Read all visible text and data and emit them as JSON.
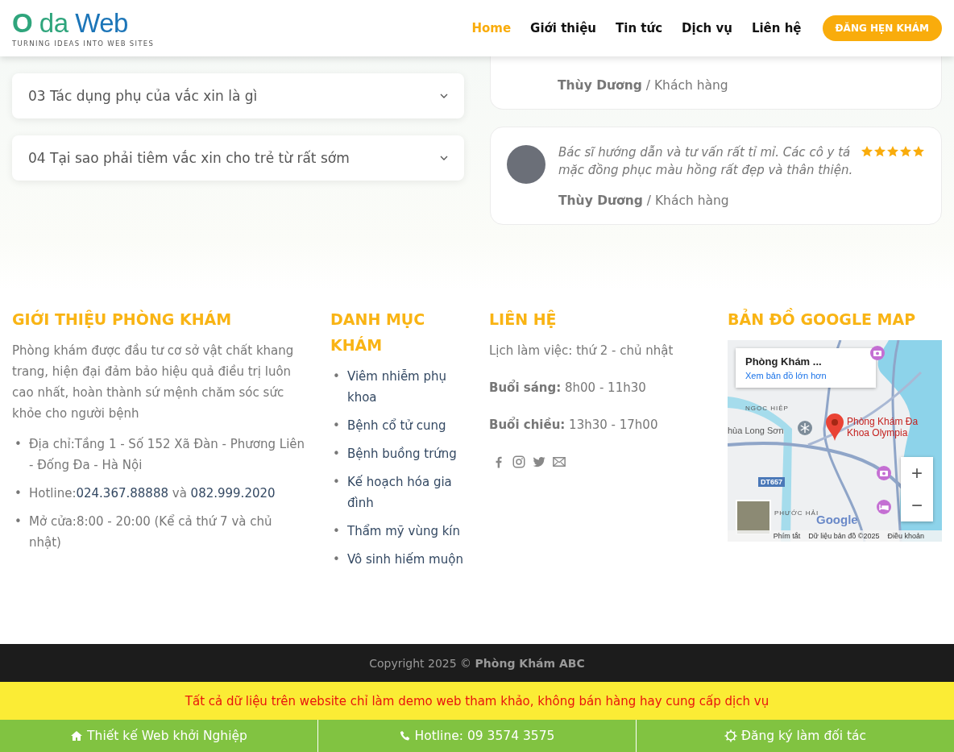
{
  "header": {
    "logo": {
      "parts": [
        "O",
        "da",
        "Web"
      ],
      "tagline": "TURNING IDEAS INTO WEB SITES"
    },
    "nav": [
      {
        "label": "Home",
        "selected": true
      },
      {
        "label": "Giới thiệu",
        "selected": false
      },
      {
        "label": "Tin tức",
        "selected": false
      },
      {
        "label": "Dịch vụ",
        "selected": false
      },
      {
        "label": "Liên hệ",
        "selected": false
      }
    ],
    "cta": "ĐĂNG HẸN KHÁM"
  },
  "faq": [
    {
      "question": "03 Tác dụng phụ của vắc xin là gì",
      "expanded": false
    },
    {
      "question": "04 Tại sao phải tiêm vắc xin cho trẻ từ rất sớm",
      "expanded": false
    }
  ],
  "testimonials": [
    {
      "kind": "partial",
      "author": "**Thùy Dương** / Khách hàng"
    },
    {
      "kind": "full",
      "quote": "Bác sĩ hướng dẫn và tư vấn rất tỉ mỉ. Các cô y tá mặc đồng phục màu hồng rất đẹp và thân thiện.",
      "stars": 5,
      "author": "**Thùy Dương** / Khách hàng"
    }
  ],
  "footer": {
    "bullet": "•",
    "about": {
      "title": "GIỚI THIỆU PHÒNG KHÁM",
      "text": "Phòng khám được đầu tư cơ sở vật chất khang trang, hiện đại đảm bảo hiệu quả điều trị luôn cao nhất, hoàn thành sứ mệnh chăm sóc sức khỏe cho người bệnh",
      "items": [
        {
          "kind": "text",
          "text": "Địa chỉ:Tầng 1 - Số 152 Xã Đàn - Phương Liên - Đống Đa - Hà Nội"
        },
        {
          "kind": "phones",
          "label": "Hotline:",
          "phones": [
            "024.367.88888",
            "082.999.2020"
          ],
          "joiner": "và"
        },
        {
          "kind": "text",
          "text": "Mở cửa:8:00 - 20:00 (Kể cả thứ 7 và chủ nhật)"
        }
      ]
    },
    "categories": {
      "title": "DANH MỤC KHÁM",
      "items": [
        "Viêm nhiễm phụ khoa",
        "Bệnh cổ tử cung",
        "Bệnh buồng trứng",
        "Kế hoạch hóa gia đình",
        "Thẩm mỹ vùng kín",
        "Vô sinh hiếm muộn"
      ]
    },
    "contact": {
      "title": "LIÊN HỆ",
      "lines": [
        "Lịch làm việc: thứ 2 - chủ nhật",
        "**Buổi sáng:** 8h00 - 11h30",
        "**Buổi chiều:** 13h30 - 17h00"
      ],
      "socials": [
        {
          "kind": "facebook"
        },
        {
          "kind": "instagram"
        },
        {
          "kind": "twitter"
        },
        {
          "kind": "email"
        }
      ]
    },
    "map": {
      "title": "BẢN ĐỒ GOOGLE MAP",
      "popup_title": "Phòng Khám ...",
      "popup_link": "Xem bản đồ lớn hơn",
      "labels": [
        "NGỌC HIỆP",
        "hùa Long Sơn",
        "PHƯỚC HẢI"
      ],
      "pin_label": [
        "Phòng Khám Đa",
        "Khoa Olympia"
      ],
      "road_badge": "DT657",
      "zoom_in": "+",
      "zoom_out": "−",
      "logo": "Google",
      "attribution": [
        "Phím tắt",
        "Dữ liệu bản đồ ©2025",
        "Điều khoản"
      ]
    }
  },
  "copyright": "Copyright 2025 © **Phòng Khám ABC**",
  "notice": "Tất cả dữ liệu trên website chỉ làm demo web tham khảo, không bán hàng hay cung cấp dịch vụ",
  "bottom_bar": [
    {
      "kind": "home",
      "label": "Thiết kế Web khởi Nghiệp"
    },
    {
      "kind": "phone",
      "label": "Hotline: 09 3574 3575"
    },
    {
      "kind": "gear",
      "label": "Đăng ký làm đối tác"
    }
  ]
}
